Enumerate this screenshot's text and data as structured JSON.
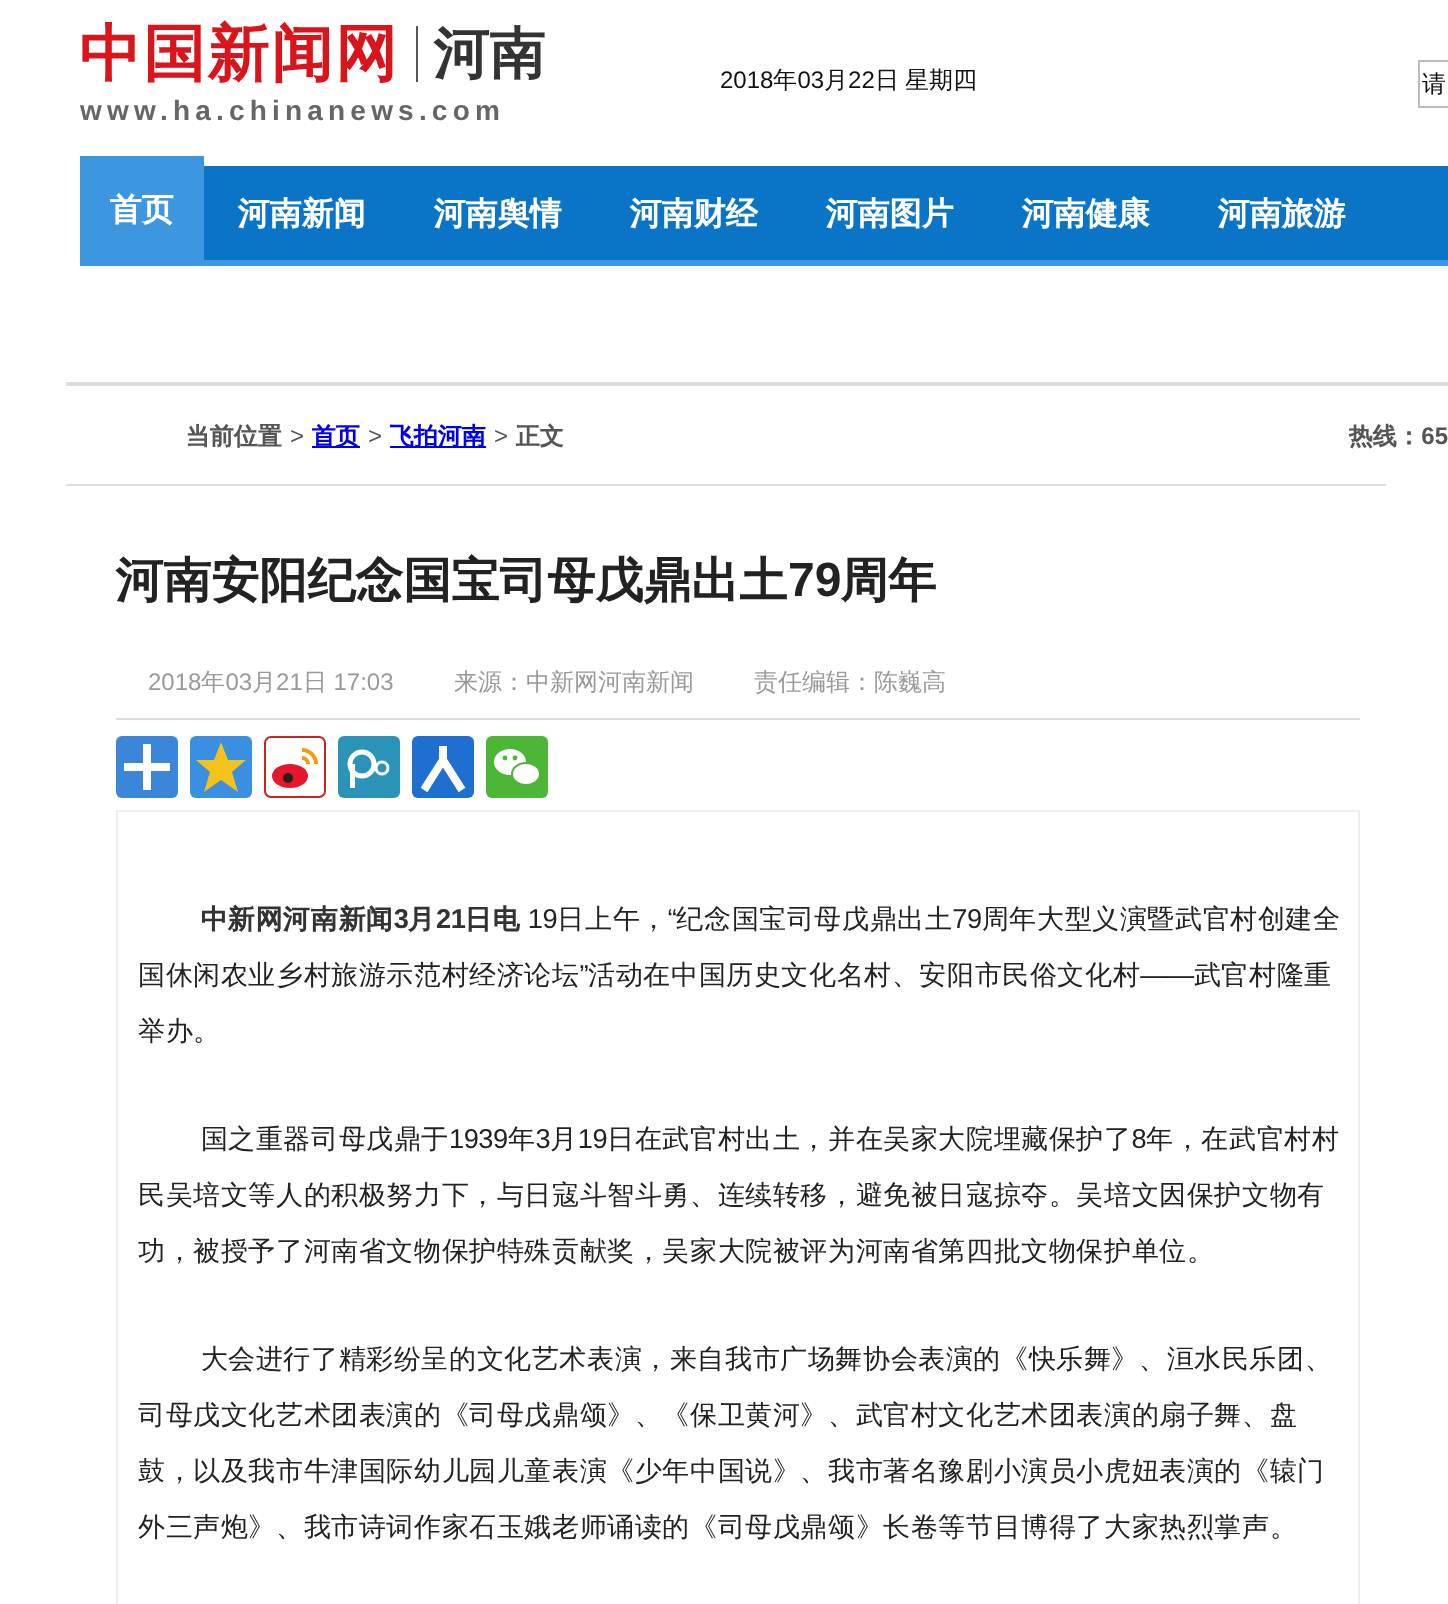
{
  "header": {
    "logo_name": "中国新闻网",
    "logo_region": "河南",
    "logo_url": "www.ha.chinanews.com",
    "date": "2018年03月22日 星期四",
    "search": {
      "placeholder": "请"
    }
  },
  "nav": [
    {
      "label": "首页",
      "selected": true
    },
    {
      "label": "河南新闻",
      "selected": false
    },
    {
      "label": "河南舆情",
      "selected": false
    },
    {
      "label": "河南财经",
      "selected": false
    },
    {
      "label": "河南图片",
      "selected": false
    },
    {
      "label": "河南健康",
      "selected": false
    },
    {
      "label": "河南旅游",
      "selected": false
    }
  ],
  "breadcrumb": {
    "label": "当前位置",
    "separator": ">",
    "items": [
      {
        "text": "首页",
        "kind": "link"
      },
      {
        "text": "飞拍河南",
        "kind": "link"
      },
      {
        "text": "正文",
        "kind": "plain"
      }
    ],
    "hotline": "热线：65"
  },
  "article": {
    "title": "河南安阳纪念国宝司母戊鼎出土79周年",
    "date": "2018年03月21日 17:03",
    "source": "来源：中新网河南新闻",
    "editor": "责任编辑：陈巍高",
    "share": [
      {
        "kind": "plus"
      },
      {
        "kind": "star"
      },
      {
        "kind": "swirl"
      },
      {
        "kind": "ring"
      },
      {
        "kind": "figure"
      },
      {
        "kind": "chat"
      }
    ],
    "paragraphs": [
      "**中新网河南新闻3月21日电** 19日上午，“纪念国宝司母戊鼎出土79周年大型义演暨武官村创建全国休闲农业乡村旅游示范村经济论坛”活动在中国历史文化名村、安阳市民俗文化村——武官村隆重举办。",
      "国之重器司母戊鼎于1939年3月19日在武官村出土，并在吴家大院埋藏保护了8年，在武官村村民吴培文等人的积极努力下，与日寇斗智斗勇、连续转移，避免被日寇掠夺。吴培文因保护文物有功，被授予了河南省文物保护特殊贡献奖，吴家大院被评为河南省第四批文物保护单位。",
      "大会进行了精彩纷呈的文化艺术表演，来自我市广场舞协会表演的《快乐舞》、洹水民乐团、司母戊文化艺术团表演的《司母戊鼎颂》、《保卫黄河》、武官村文化艺术团表演的扇子舞、盘鼓，以及我市牛津国际幼儿园儿童表演《少年中国说》、我市著名豫剧小演员小虎妞表演的《辕门外三声炮》、我市诗词作家石玉娥老师诵读的《司母戊鼎颂》长卷等节目博得了大家热烈掌声。"
    ]
  }
}
